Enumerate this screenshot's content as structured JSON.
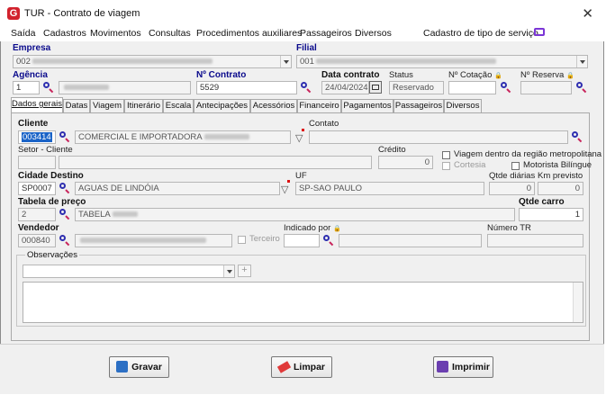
{
  "window": {
    "title": "TUR - Contrato de viagem",
    "close_glyph": "✕",
    "logo_letter": "G"
  },
  "menu": [
    {
      "label": "Saída"
    },
    {
      "label": "Cadastros"
    },
    {
      "label": "Movimentos"
    },
    {
      "label": "Consultas"
    },
    {
      "label": "Procedimentos auxiliares"
    },
    {
      "label": "Passageiros"
    },
    {
      "label": "Diversos"
    },
    {
      "label": "Cadastro de tipo de serviço"
    }
  ],
  "header": {
    "empresa": {
      "label": "Empresa",
      "code": "002"
    },
    "filial": {
      "label": "Filial",
      "code": "001"
    },
    "agencia": {
      "label": "Agência",
      "value": "1"
    },
    "contrato": {
      "label": "Nº Contrato",
      "value": "5529"
    },
    "data_contrato": {
      "label": "Data contrato",
      "value": "24/04/2024"
    },
    "status": {
      "label": "Status",
      "value": "Reservado"
    },
    "cotacao": {
      "label": "Nº Cotação",
      "lock": "🔒",
      "value": ""
    },
    "reserva": {
      "label": "Nº Reserva",
      "lock": "🔒",
      "value": ""
    }
  },
  "tabs": [
    {
      "label": "Dados gerais"
    },
    {
      "label": "Datas"
    },
    {
      "label": "Viagem"
    },
    {
      "label": "Itinerário"
    },
    {
      "label": "Escala"
    },
    {
      "label": "Antecipações"
    },
    {
      "label": "Acessórios"
    },
    {
      "label": "Financeiro"
    },
    {
      "label": "Pagamentos"
    },
    {
      "label": "Passageiros"
    },
    {
      "label": "Diversos"
    }
  ],
  "form": {
    "cliente": {
      "label": "Cliente",
      "code": "003414",
      "name": "COMERCIAL E IMPORTADORA"
    },
    "contato": {
      "label": "Contato",
      "value": ""
    },
    "setor": {
      "label": "Setor - Cliente",
      "value": ""
    },
    "credito": {
      "label": "Crédito",
      "value": "0"
    },
    "viagem_metro": {
      "label": "Viagem dentro da região metropolitana"
    },
    "cortesia": {
      "label": "Cortesia"
    },
    "motorista": {
      "label": "Motorista Bilíngue"
    },
    "cidade": {
      "label": "Cidade Destino",
      "code": "SP0007",
      "name": "AGUAS DE LINDÓIA"
    },
    "uf": {
      "label": "UF",
      "value": "SP-SAO PAULO"
    },
    "qtde_diarias": {
      "label": "Qtde diárias",
      "value": "0"
    },
    "km_previsto": {
      "label": "Km previsto",
      "value": "0"
    },
    "tabela": {
      "label": "Tabela de preço",
      "code": "2",
      "name": "TABELA"
    },
    "qtde_carro": {
      "label": "Qtde carro",
      "value": "1"
    },
    "vendedor": {
      "label": "Vendedor",
      "code": "000840",
      "name": ""
    },
    "terceiro": {
      "label": "Terceiro"
    },
    "indicado": {
      "label": "Indicado por",
      "lock": "🔒",
      "value": ""
    },
    "numero_tr": {
      "label": "Número TR",
      "value": ""
    },
    "observacoes": {
      "label": "Observações",
      "add": "+"
    }
  },
  "buttons": {
    "gravar": "Gravar",
    "limpar": "Limpar",
    "imprimir": "Imprimir"
  },
  "colors": {
    "accent": "#2f2fb0",
    "logo": "#d2222d",
    "label_blue": "#0a0a8c"
  }
}
